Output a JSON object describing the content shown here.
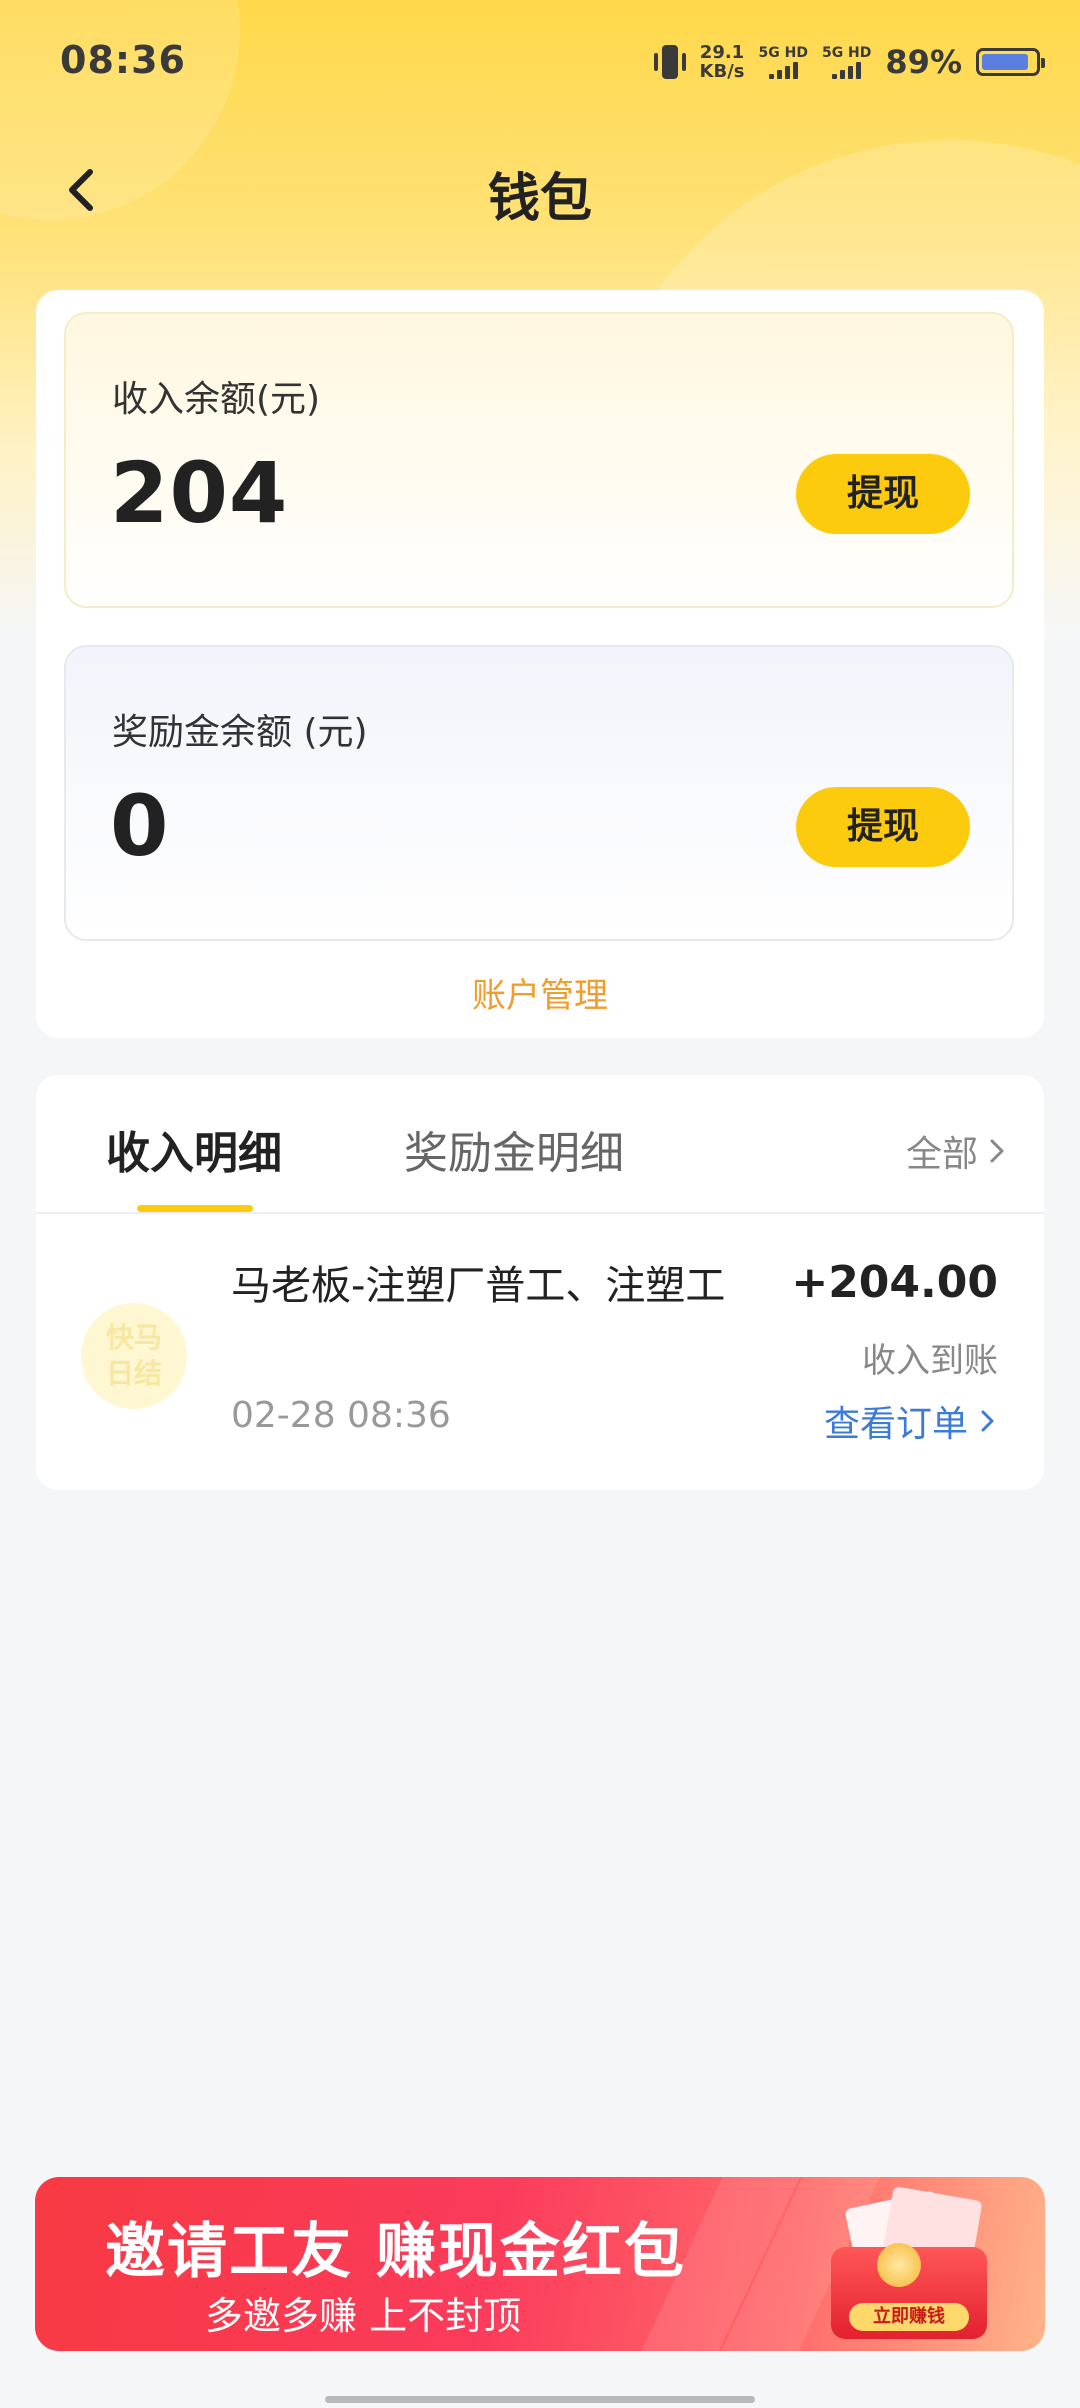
{
  "status_bar": {
    "time": "08:36",
    "net_speed_value": "29.1",
    "net_speed_unit": "KB/s",
    "sim1_label": "5G HD",
    "sim2_label": "5G HD",
    "battery_percent": "89%",
    "battery_level": 0.89,
    "battery_color": "#5b7fe0"
  },
  "nav": {
    "back_icon": "chevron-left-icon",
    "title": "钱包"
  },
  "wallet": {
    "income": {
      "label": "收入余额(元)",
      "value": "204",
      "button": "提现"
    },
    "reward": {
      "label": "奖励金余额 (元)",
      "value": "0",
      "button": "提现"
    },
    "account_link": "账户管理",
    "accent_color": "#fccb0e",
    "link_color": "#f19c2b"
  },
  "details": {
    "tabs": [
      {
        "label": "收入明细",
        "active": true
      },
      {
        "label": "奖励金明细",
        "active": false
      }
    ],
    "filter": "全部",
    "records": [
      {
        "logo_text_line1": "快马",
        "logo_text_line2": "日结",
        "title": "马老板-注塑厂普工、注塑工",
        "amount": "+204.00",
        "status": "收入到账",
        "time": "02-28 08:36",
        "action": "查看订单"
      }
    ],
    "action_color": "#3d7bd9"
  },
  "banner": {
    "title": "邀请工友 赚现金红包",
    "subtitle": "多邀多赚 上不封顶",
    "cta": "立即赚钱",
    "bg_color": "#f73a43"
  }
}
